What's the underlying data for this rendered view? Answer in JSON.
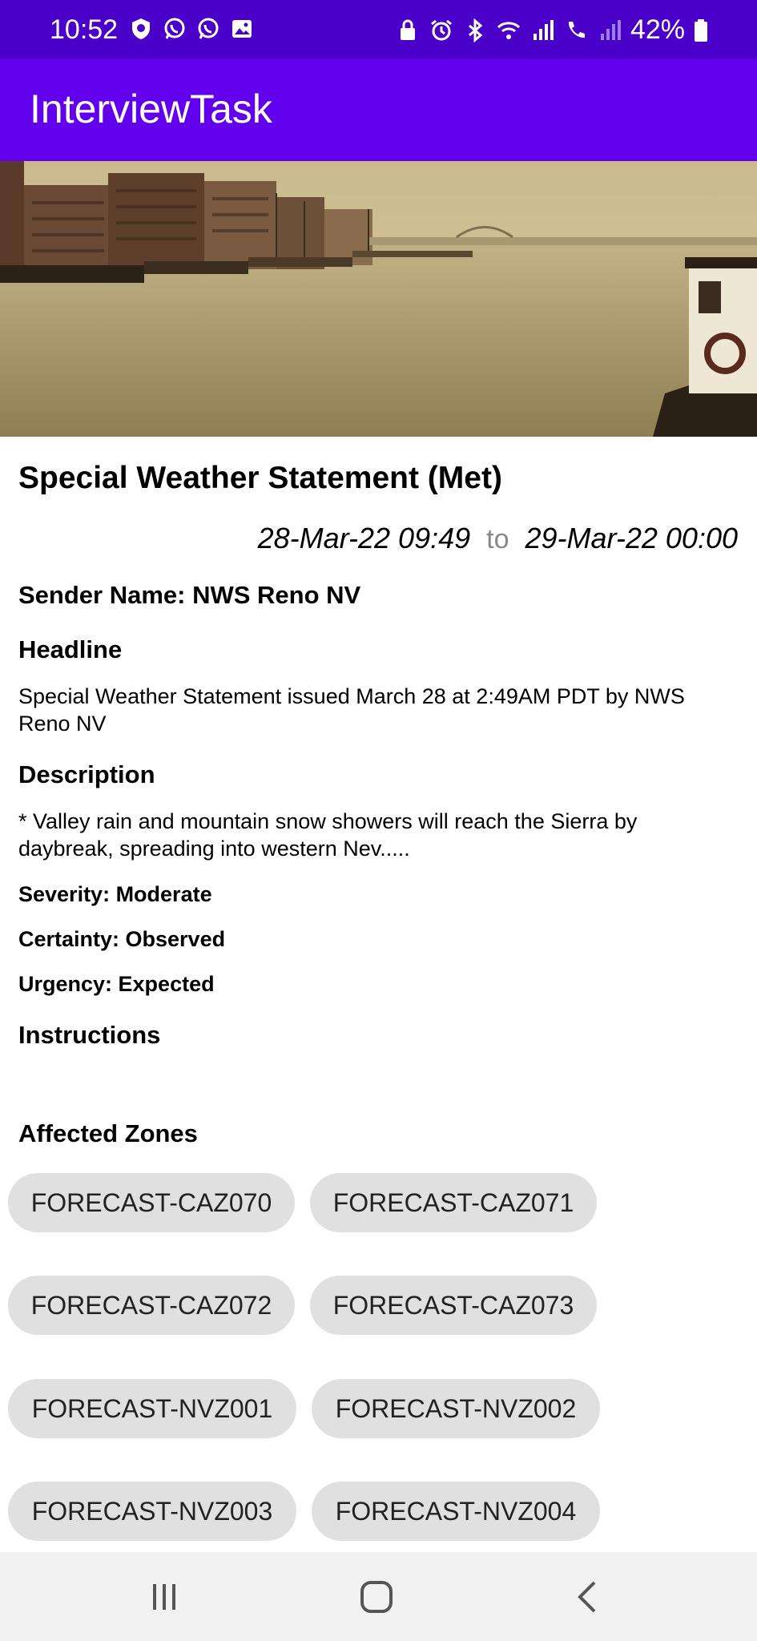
{
  "status_bar": {
    "time": "10:52",
    "battery_percent": "42%",
    "left_icons": [
      "shield-icon",
      "whatsapp-icon",
      "whatsapp-icon",
      "image-icon"
    ],
    "right_icons": [
      "lock-icon",
      "alarm-icon",
      "bluetooth-icon",
      "wifi-icon",
      "signal-icon",
      "call-icon",
      "signal-icon",
      "battery-icon"
    ]
  },
  "app_bar": {
    "title": "InterviewTask"
  },
  "alert": {
    "title": "Special Weather Statement (Met)",
    "start": "28-Mar-22 09:49",
    "to_label": "to",
    "end": "29-Mar-22 00:00",
    "sender": "Sender Name: NWS Reno NV",
    "headline_label": "Headline",
    "headline": "Special Weather Statement issued March 28 at 2:49AM PDT by NWS Reno NV",
    "description_label": "Description",
    "description": "* Valley rain and mountain snow showers will reach the Sierra by daybreak, spreading into western Nev.....",
    "severity": "Severity: Moderate",
    "certainty": "Certainty: Observed",
    "urgency": "Urgency: Expected",
    "instructions_label": "Instructions",
    "zones_label": "Affected Zones"
  },
  "zones": [
    "FORECAST-CAZ070",
    "FORECAST-CAZ071",
    "FORECAST-CAZ072",
    "FORECAST-CAZ073",
    "FORECAST-NVZ001",
    "FORECAST-NVZ002",
    "FORECAST-NVZ003",
    "FORECAST-NVZ004"
  ],
  "nav_bar": {
    "icons": [
      "recent-apps-icon",
      "home-icon",
      "back-icon"
    ]
  },
  "colors": {
    "status_bar": "#4a00c8",
    "app_bar": "#6200ee",
    "chip": "#e0e0e0"
  }
}
